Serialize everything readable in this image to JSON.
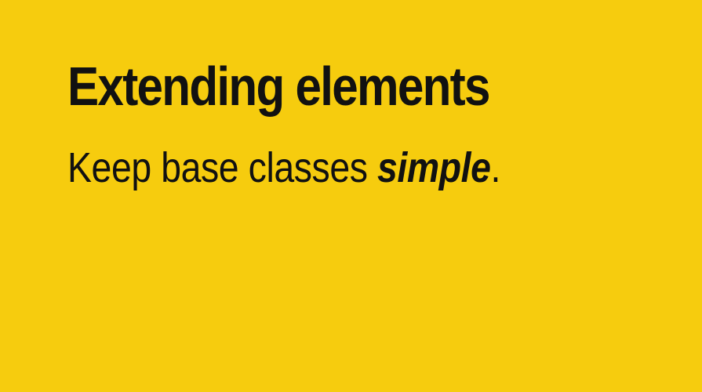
{
  "slide": {
    "background_color": "#F6CC0E",
    "text_color": "#111111",
    "title": "Extending elements",
    "subtitle": {
      "before": "Keep base classes ",
      "emphasis": "simple",
      "after": "."
    }
  }
}
